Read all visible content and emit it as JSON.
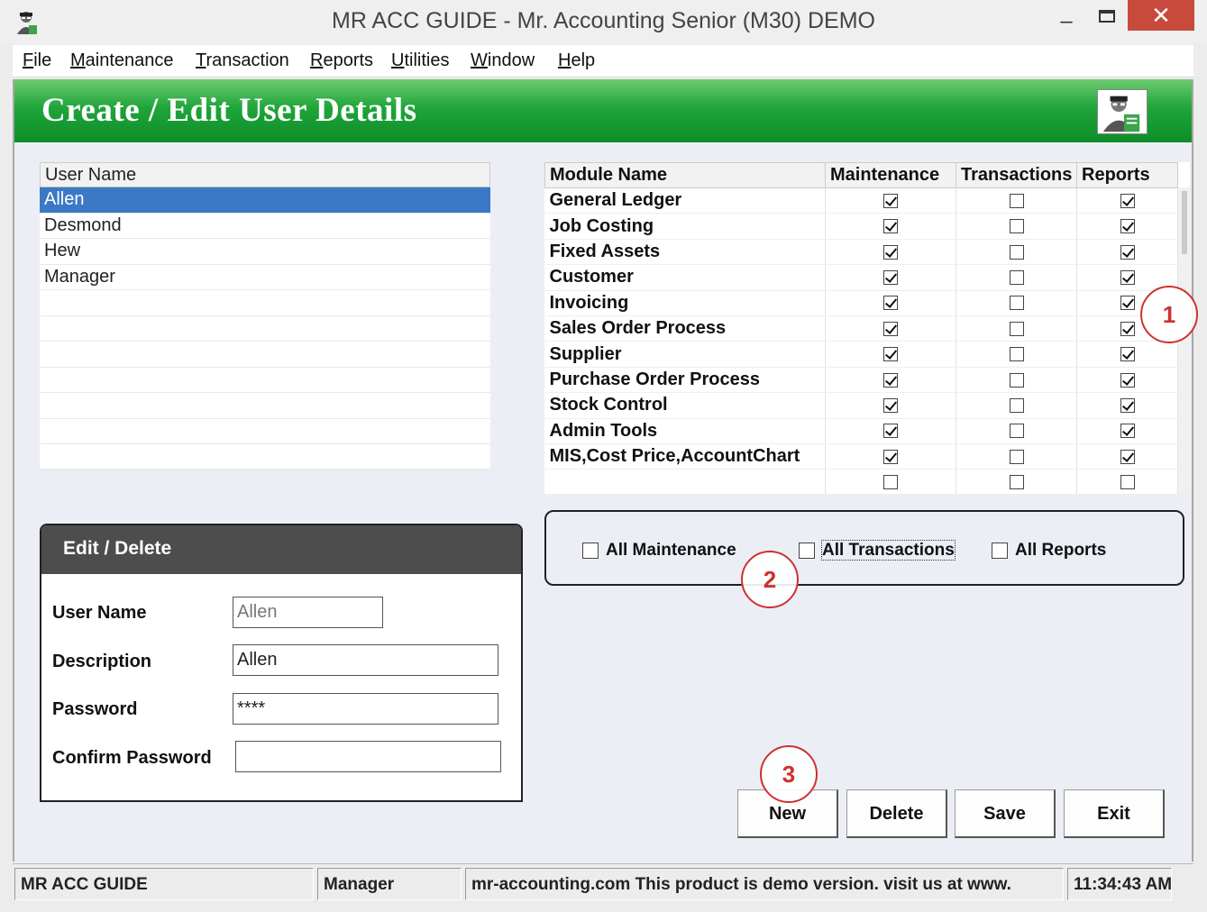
{
  "window": {
    "title": "MR ACC GUIDE - Mr. Accounting Senior (M30) DEMO",
    "min_glyph": "–",
    "close_glyph": "✕"
  },
  "menu": [
    "File",
    "Maintenance",
    "Transaction",
    "Reports",
    "Utilities",
    "Window",
    "Help"
  ],
  "banner": {
    "heading": "Create / Edit User Details"
  },
  "users": {
    "header": "User Name",
    "rows": [
      "Allen",
      "Desmond",
      "Hew",
      "Manager"
    ],
    "selected_index": 0
  },
  "modules": {
    "headers": [
      "Module Name",
      "Maintenance",
      "Transactions",
      "Reports"
    ],
    "rows": [
      {
        "name": "General Ledger",
        "maintenance": true,
        "transactions": false,
        "reports": true
      },
      {
        "name": "Job Costing",
        "maintenance": true,
        "transactions": false,
        "reports": true
      },
      {
        "name": "Fixed Assets",
        "maintenance": true,
        "transactions": false,
        "reports": true
      },
      {
        "name": "Customer",
        "maintenance": true,
        "transactions": false,
        "reports": true
      },
      {
        "name": "Invoicing",
        "maintenance": true,
        "transactions": false,
        "reports": true
      },
      {
        "name": "Sales Order Process",
        "maintenance": true,
        "transactions": false,
        "reports": true
      },
      {
        "name": "Supplier",
        "maintenance": true,
        "transactions": false,
        "reports": true
      },
      {
        "name": "Purchase Order Process",
        "maintenance": true,
        "transactions": false,
        "reports": true
      },
      {
        "name": "Stock Control",
        "maintenance": true,
        "transactions": false,
        "reports": true
      },
      {
        "name": "Admin Tools",
        "maintenance": true,
        "transactions": false,
        "reports": true
      },
      {
        "name": "MIS,Cost Price,AccountChart",
        "maintenance": true,
        "transactions": false,
        "reports": true
      },
      {
        "name": "",
        "maintenance": false,
        "transactions": false,
        "reports": false
      }
    ]
  },
  "all_select": {
    "maintenance": "All Maintenance",
    "transactions": "All Transactions",
    "reports": "All Reports"
  },
  "edit_panel": {
    "title": "Edit / Delete",
    "user_name_label": "User Name",
    "user_name_value": "Allen",
    "description_label": "Description",
    "description_value": "Allen",
    "password_label": "Password",
    "password_value": "****",
    "confirm_label": "Confirm Password",
    "confirm_value": ""
  },
  "buttons": {
    "new": "New",
    "delete": "Delete",
    "save": "Save",
    "exit": "Exit"
  },
  "callouts": [
    "1",
    "2",
    "3"
  ],
  "status": {
    "app": "MR ACC GUIDE",
    "user": "Manager",
    "message": "mr-accounting.com This product is demo version.  visit us at www.",
    "time": "11:34:43 AM"
  },
  "colors": {
    "banner_green": "#1fa53a",
    "selection_blue": "#3b79c6",
    "callout_red": "#d03030",
    "close_red": "#c74a3d"
  },
  "icons": [
    "app-user-icon",
    "banner-user-icon"
  ]
}
